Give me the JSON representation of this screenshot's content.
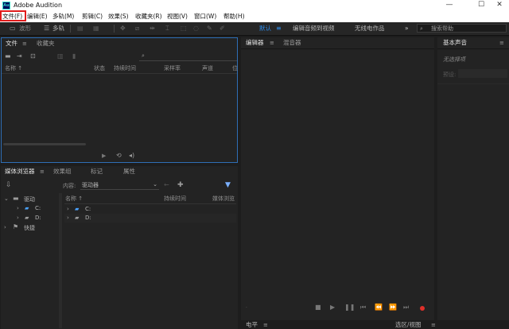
{
  "window": {
    "app_icon_text": "Au",
    "title": "Adobe Audition",
    "minimize": "—",
    "maximize": "☐",
    "close": "✕"
  },
  "menu": [
    "文件(F)",
    "编辑(E)",
    "多轨(M)",
    "剪辑(C)",
    "效果(S)",
    "收藏夹(R)",
    "视图(V)",
    "窗口(W)",
    "帮助(H)"
  ],
  "toolbar": {
    "waveform_label": "波形",
    "multitrack_label": "多轨",
    "workspace_default": "默认",
    "workspace_edit_video": "编辑音频到视频",
    "workspace_radio": "无线电作品",
    "more": "»",
    "search_placeholder": "搜索帮助"
  },
  "files_panel": {
    "tab_files": "文件",
    "tab_favorites": "收藏夹",
    "columns": [
      "名称 ↑",
      "状态",
      "持续时间",
      "采样率",
      "声道",
      "位"
    ]
  },
  "media_browser": {
    "tabs": [
      "媒体浏览器",
      "效果组",
      "标记",
      "属性"
    ],
    "content_label": "内容:",
    "content_value": "驱动器",
    "tree_root": "驱动",
    "tree_items": [
      "C:",
      "D:"
    ],
    "shortcuts": "快捷",
    "list_columns": [
      "名称 ↑",
      "持续时间",
      "媒体浏览"
    ],
    "list_items": [
      "C:",
      "D:"
    ]
  },
  "editor": {
    "tab_editor": "编辑器",
    "tab_mixer": "混音器"
  },
  "essential_sound": {
    "title": "基本声音",
    "no_selection": "无选择项",
    "preset_label": "预设:"
  },
  "bottom": {
    "level_tab": "电平",
    "selection_tab": "选区/视图"
  }
}
